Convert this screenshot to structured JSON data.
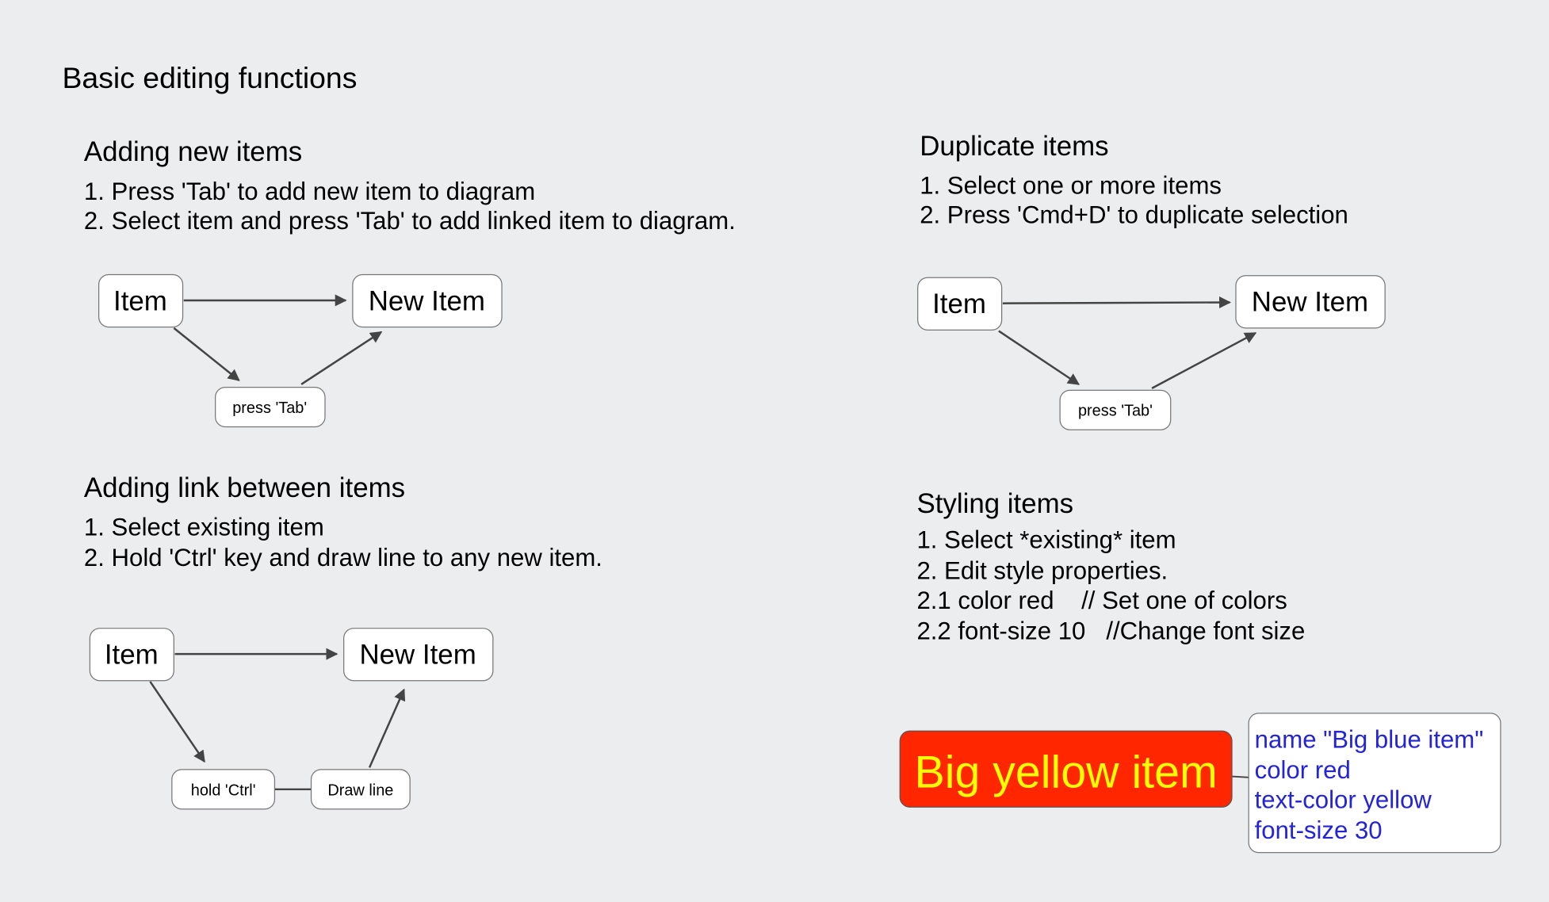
{
  "title": "Basic editing functions",
  "sections": {
    "adding_new": {
      "heading": "Adding new items",
      "lines": [
        "1. Press 'Tab' to add new item to diagram",
        "2. Select item and press 'Tab' to add linked item to diagram."
      ],
      "diagram": {
        "item": "Item",
        "new_item": "New Item",
        "step": "press 'Tab'"
      }
    },
    "adding_link": {
      "heading": "Adding link between items",
      "lines": [
        "1. Select existing item",
        "2. Hold 'Ctrl' key and draw line to any new item."
      ],
      "diagram": {
        "item": "Item",
        "new_item": "New Item",
        "step1": "hold 'Ctrl'",
        "step2": "Draw line"
      }
    },
    "duplicate": {
      "heading": "Duplicate items",
      "lines": [
        "1. Select one or more items",
        "2. Press 'Cmd+D' to duplicate selection"
      ],
      "diagram": {
        "item": "Item",
        "new_item": "New Item",
        "step": "press 'Tab'"
      }
    },
    "styling": {
      "heading": "Styling items",
      "lines": [
        "1. Select *existing* item",
        "2. Edit style properties.",
        "2.1 color red    // Set one of colors",
        "2.2 font-size 10   //Change font size"
      ],
      "example": {
        "label": "Big yellow item",
        "fill_color": "#ff2600",
        "text_color": "#ffff00",
        "note_color": "#2323d8",
        "note_lines": [
          "name \"Big blue item\"",
          "color red",
          "text-color yellow",
          "font-size 30"
        ]
      }
    }
  }
}
